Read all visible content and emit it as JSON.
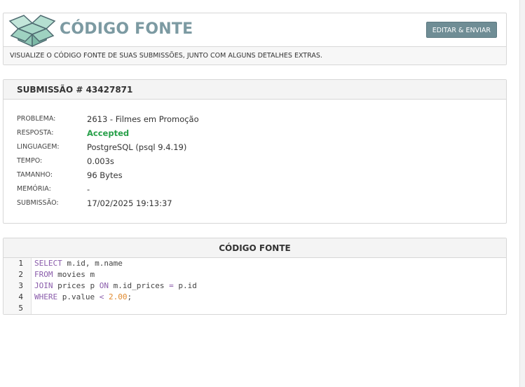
{
  "header": {
    "title": "CÓDIGO FONTE",
    "button_label": "EDITAR & ENVIAR",
    "subtitle": "VISUALIZE O CÓDIGO FONTE DE SUAS SUBMISSÕES, JUNTO COM ALGUNS DETALHES EXTRAS."
  },
  "submission": {
    "title": "SUBMISSÃO # 43427871",
    "fields": [
      {
        "label": "PROBLEMA:",
        "value": "2613 - Filmes em Promoção"
      },
      {
        "label": "RESPOSTA:",
        "value": "Accepted"
      },
      {
        "label": "LINGUAGEM:",
        "value": "PostgreSQL (psql 9.4.19)"
      },
      {
        "label": "TEMPO:",
        "value": "0.003s"
      },
      {
        "label": "TAMANHO:",
        "value": "96 Bytes"
      },
      {
        "label": "MEMÓRIA:",
        "value": "-"
      },
      {
        "label": "SUBMISSÃO:",
        "value": "17/02/2025 19:13:37"
      }
    ],
    "accepted_color": "#27a049"
  },
  "code": {
    "title": "CÓDIGO FONTE",
    "lines": [
      {
        "num": "1",
        "tokens": [
          [
            "kw",
            "SELECT"
          ],
          [
            "t",
            " m.id, m.name"
          ]
        ]
      },
      {
        "num": "2",
        "tokens": [
          [
            "kw",
            "FROM"
          ],
          [
            "t",
            " movies m"
          ]
        ]
      },
      {
        "num": "3",
        "tokens": [
          [
            "kw",
            "JOIN"
          ],
          [
            "t",
            " prices p "
          ],
          [
            "kw",
            "ON"
          ],
          [
            "t",
            " m.id_prices "
          ],
          [
            "op",
            "="
          ],
          [
            "t",
            " p.id"
          ]
        ]
      },
      {
        "num": "4",
        "tokens": [
          [
            "kw",
            "WHERE"
          ],
          [
            "t",
            " p.value "
          ],
          [
            "op",
            "<"
          ],
          [
            "t",
            " "
          ],
          [
            "num",
            "2.00"
          ],
          [
            "t",
            ";"
          ]
        ]
      },
      {
        "num": "5",
        "tokens": []
      }
    ]
  },
  "icons": {
    "logo": "open-box-logo-icon"
  }
}
